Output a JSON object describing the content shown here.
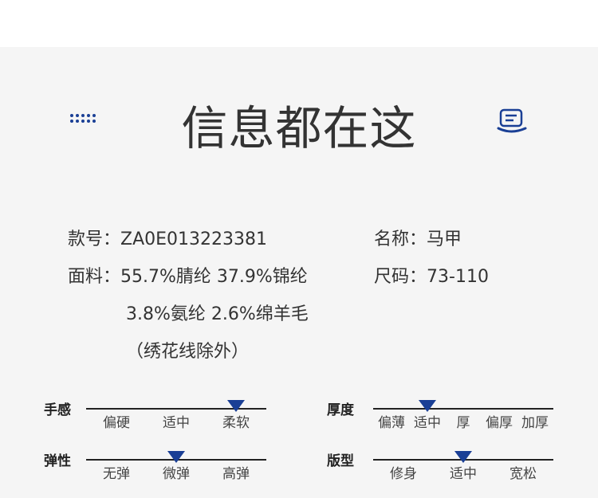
{
  "colors": {
    "accent": "#1a3f95",
    "panel": "#f5f5f5",
    "text": "#333333"
  },
  "header": {
    "title": "信息都在这",
    "left_icon": "grid-dots-icon",
    "right_icon": "note-icon"
  },
  "info": {
    "style_label": "款号：",
    "style_value": "ZA0E013223381",
    "name_label": "名称：",
    "name_value": "马甲",
    "fabric_label": "面料：",
    "fabric_line1": "55.7%腈纶 37.9%锦纶",
    "fabric_line2": "3.8%氨纶 2.6%绵羊毛",
    "fabric_line3": "（绣花线除外）",
    "size_label": "尺码：",
    "size_value": "73-110"
  },
  "scales": {
    "feel": {
      "label": "手感",
      "options": [
        "偏硬",
        "适中",
        "柔软"
      ],
      "selected_index": 2
    },
    "thickness": {
      "label": "厚度",
      "options": [
        "偏薄",
        "适中",
        "厚",
        "偏厚",
        "加厚"
      ],
      "selected_index": 1
    },
    "elasticity": {
      "label": "弹性",
      "options": [
        "无弹",
        "微弹",
        "高弹"
      ],
      "selected_index": 1
    },
    "fit": {
      "label": "版型",
      "options": [
        "修身",
        "适中",
        "宽松"
      ],
      "selected_index": 1
    }
  }
}
